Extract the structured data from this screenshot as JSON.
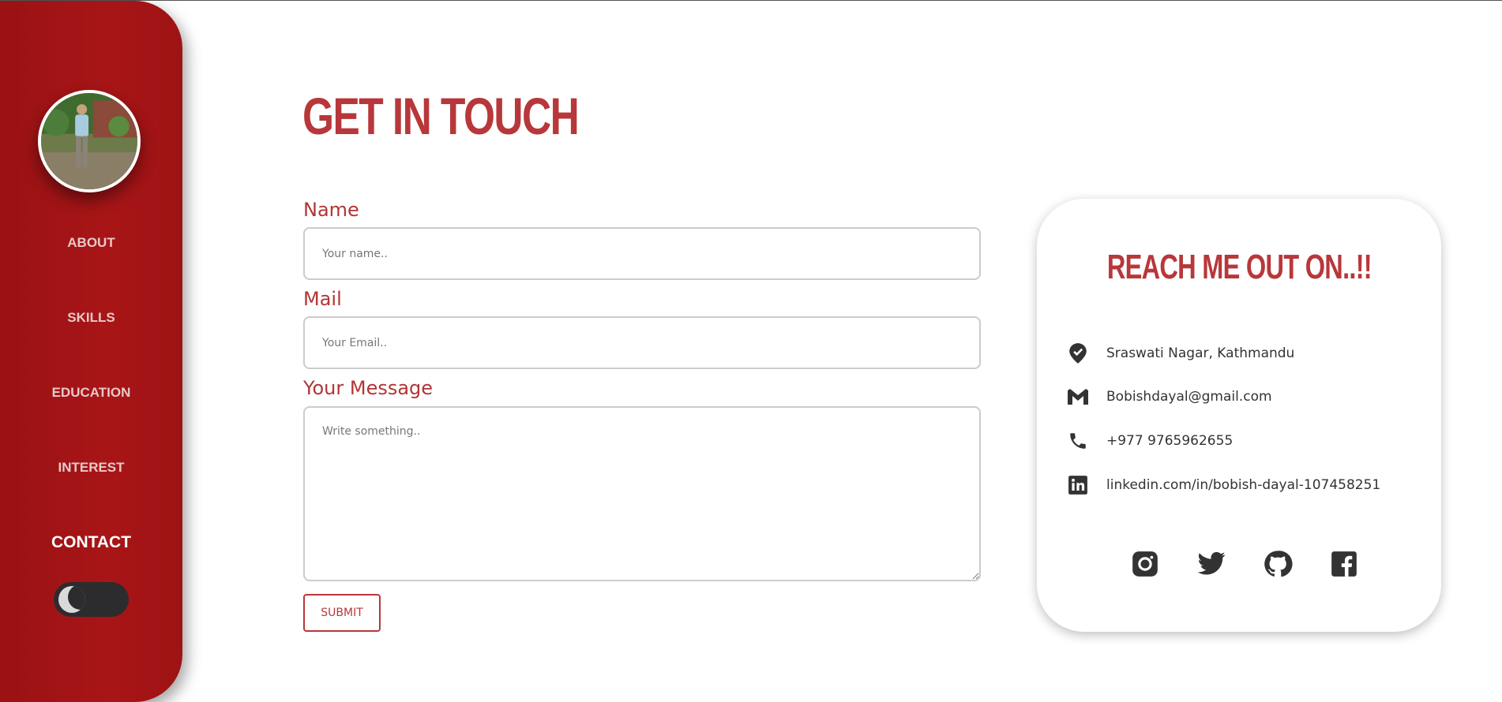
{
  "sidebar": {
    "avatar_alt": "profile photo",
    "nav": [
      {
        "label": "ABOUT"
      },
      {
        "label": "SKILLS"
      },
      {
        "label": "EDUCATION"
      },
      {
        "label": "INTEREST"
      },
      {
        "label": "CONTACT",
        "active": true
      }
    ],
    "theme_toggle": {
      "icon": "moon-icon",
      "state": "dark-mode-off"
    }
  },
  "main": {
    "title": "GET IN TOUCH",
    "form": {
      "name_label": "Name",
      "name_placeholder": "Your name..",
      "mail_label": "Mail",
      "mail_placeholder": "Your Email..",
      "message_label": "Your Message",
      "message_placeholder": "Write something..",
      "submit_label": "SUBMIT"
    }
  },
  "card": {
    "title": "REACH ME OUT ON..!!",
    "contacts": [
      {
        "icon": "location-check-icon",
        "text": "Sraswati Nagar, Kathmandu"
      },
      {
        "icon": "gmail-icon",
        "text": "Bobishdayal@gmail.com"
      },
      {
        "icon": "phone-icon",
        "text": "+977 9765962655"
      },
      {
        "icon": "linkedin-icon",
        "text": "linkedin.com/in/bobish-dayal-107458251"
      }
    ],
    "socials": [
      "instagram-icon",
      "twitter-icon",
      "github-icon",
      "facebook-icon"
    ]
  },
  "colors": {
    "sidebar": "#a51416",
    "accent": "#b8373a",
    "icon": "#333333"
  }
}
